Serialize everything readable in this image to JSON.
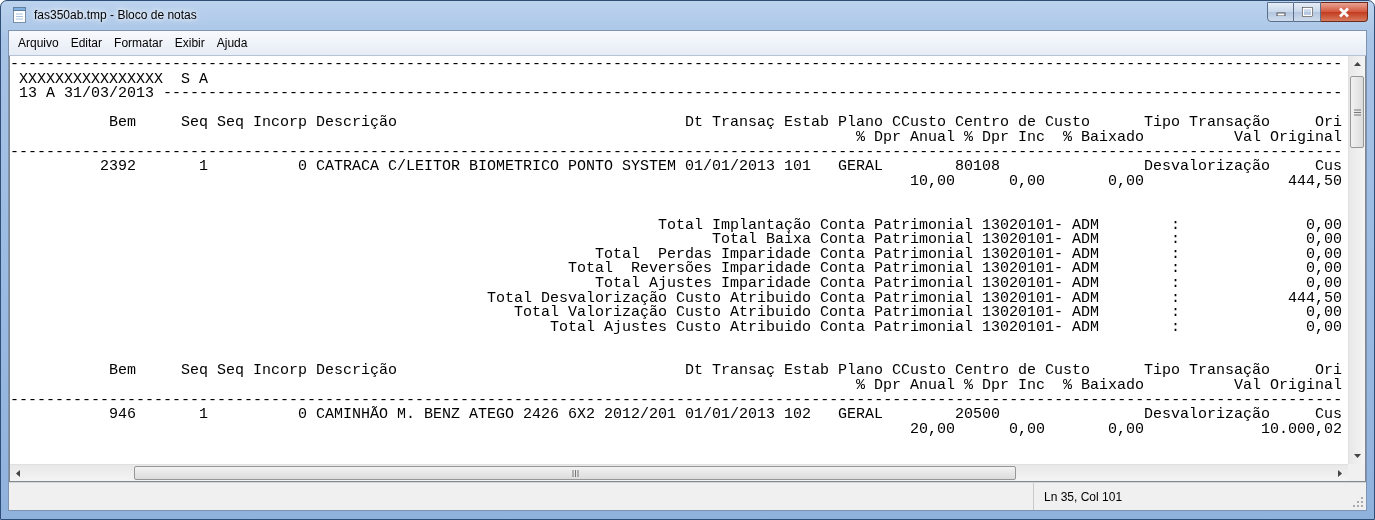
{
  "window": {
    "title": "fas350ab.tmp - Bloco de notas"
  },
  "menu": [
    "Arquivo",
    "Editar",
    "Formatar",
    "Exibir",
    "Ajuda"
  ],
  "lines": [
    {
      "kind": "rule",
      "cells": [
        "----------------------------------------------------------------------------------------------------------------------------------------------------"
      ]
    },
    {
      "kind": "title",
      "cells": [
        "XXXXXXXXXXXXXXXX",
        "S A"
      ]
    },
    {
      "kind": "period",
      "cells": [
        "13 A 31/03/2013 -----------------------------------------------------------------------------------------------------------------------------------"
      ]
    },
    {
      "kind": "blank"
    },
    {
      "kind": "header1",
      "cells": [
        "Bem",
        "Seq Seq Incorp Descrição",
        "Dt Transaç Estab Plano CCusto Centro de Custo",
        "Tipo Transação",
        "Ori"
      ]
    },
    {
      "kind": "header2",
      "cells": [
        "% Dpr Anual % Dpr Inc",
        "% Baixado",
        "Val Original"
      ]
    },
    {
      "kind": "rule",
      "cells": [
        "----------------------------------------------------------------------------------------------------------------------------------------------------"
      ]
    },
    {
      "kind": "record1",
      "cells": [
        "2392",
        "1",
        "0 CATRACA C/LEITOR BIOMETRICO PONTO SYSTEM 01/01/2013 101",
        "GERAL",
        "80108",
        "Desvalorização",
        "Cus"
      ]
    },
    {
      "kind": "record2",
      "cells": [
        "10,00",
        "0,00",
        "0,00",
        "444,50"
      ]
    },
    {
      "kind": "blank"
    },
    {
      "kind": "blank"
    },
    {
      "kind": "total",
      "cells": [
        "Total Implantação Conta Patrimonial 13020101- ADM",
        ":",
        "0,00"
      ]
    },
    {
      "kind": "total",
      "cells": [
        "Total Baixa Conta Patrimonial 13020101- ADM",
        ":",
        "0,00"
      ]
    },
    {
      "kind": "total",
      "cells": [
        "Total  Perdas Imparidade Conta Patrimonial 13020101- ADM",
        ":",
        "0,00"
      ]
    },
    {
      "kind": "total",
      "cells": [
        "Total  Reversões Imparidade Conta Patrimonial 13020101- ADM",
        ":",
        "0,00"
      ]
    },
    {
      "kind": "total",
      "cells": [
        "Total Ajustes Imparidade Conta Patrimonial 13020101- ADM",
        ":",
        "0,00"
      ]
    },
    {
      "kind": "total",
      "cells": [
        "Total Desvalorização Custo Atribuido Conta Patrimonial 13020101- ADM",
        ":",
        "444,50"
      ]
    },
    {
      "kind": "total",
      "cells": [
        "Total Valorização Custo Atribuido Conta Patrimonial 13020101- ADM",
        ":",
        "0,00"
      ]
    },
    {
      "kind": "total",
      "cells": [
        "Total Ajustes Custo Atribuido Conta Patrimonial 13020101- ADM",
        ":",
        "0,00"
      ]
    },
    {
      "kind": "blank"
    },
    {
      "kind": "blank"
    },
    {
      "kind": "header1",
      "cells": [
        "Bem",
        "Seq Seq Incorp Descrição",
        "Dt Transaç Estab Plano CCusto Centro de Custo",
        "Tipo Transação",
        "Ori"
      ]
    },
    {
      "kind": "header2",
      "cells": [
        "% Dpr Anual % Dpr Inc",
        "% Baixado",
        "Val Original"
      ]
    },
    {
      "kind": "rule",
      "cells": [
        "----------------------------------------------------------------------------------------------------------------------------------------------------"
      ]
    },
    {
      "kind": "record1",
      "cells": [
        "946",
        "1",
        "0 CAMINHÃO M. BENZ ATEGO 2426 6X2 2012/201 01/01/2013 102",
        "GERAL",
        "20500",
        "Desvalorização",
        "Cus"
      ]
    },
    {
      "kind": "record2",
      "cells": [
        "20,00",
        "0,00",
        "0,00",
        "10.000,02"
      ]
    }
  ],
  "status_bar": {
    "position": "Ln 35, Col 101"
  }
}
